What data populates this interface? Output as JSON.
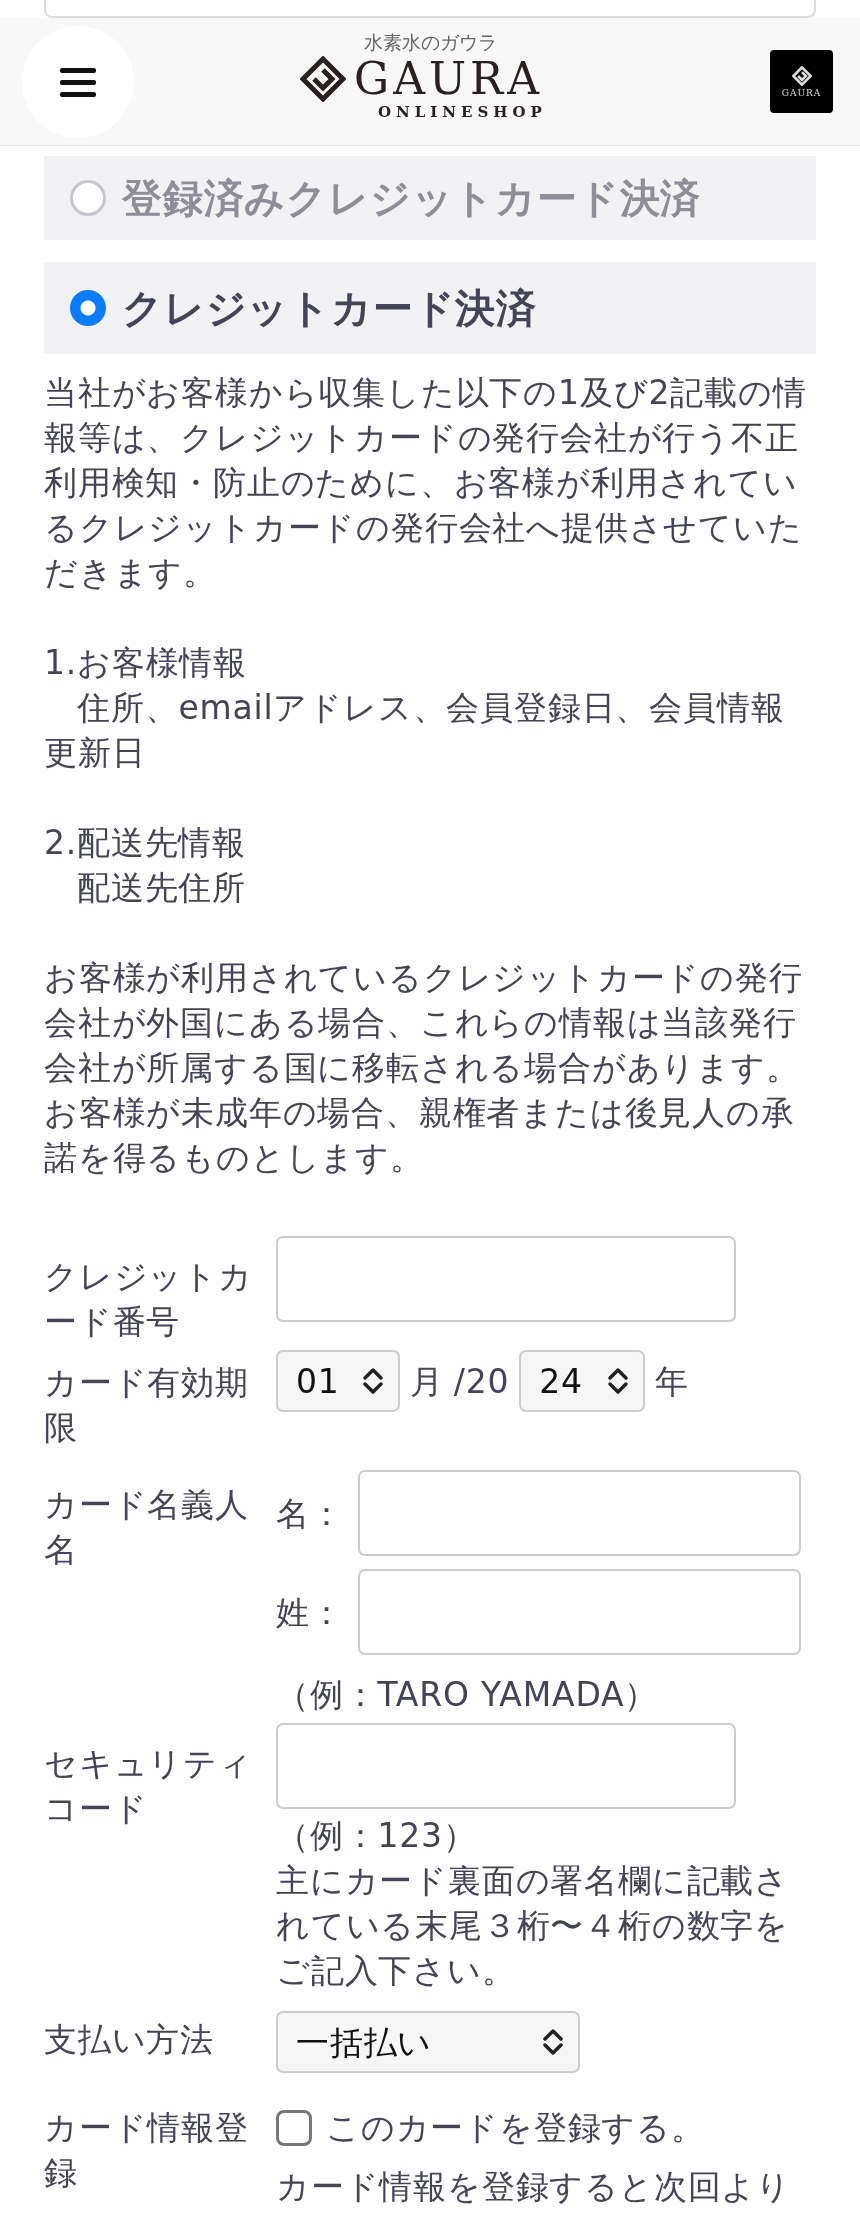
{
  "header": {
    "tagline": "水素水のガウラ",
    "logo_text": "GAURA",
    "logo_subtext": "ONLINESHOP",
    "badge_text": "GAURA"
  },
  "payment_options": [
    {
      "label": "登録済みクレジットカード決済",
      "selected": false
    },
    {
      "label": "クレジットカード決済",
      "selected": true
    }
  ],
  "notice": {
    "intro": "当社がお客様から収集した以下の1及び2記載の情報等は、クレジットカードの発行会社が行う不正利用検知・防止のために、お客様が利用されているクレジットカードの発行会社へ提供させていただきます。",
    "sections": [
      {
        "heading": "1.お客様情報",
        "detail": "住所、emailアドレス、会員登録日、会員情報更新日"
      },
      {
        "heading": "2.配送先情報",
        "detail": "配送先住所"
      }
    ],
    "closing": "お客様が利用されているクレジットカードの発行会社が外国にある場合、これらの情報は当該発行会社が所属する国に移転される場合があります。お客様が未成年の場合、親権者または後見人の承諾を得るものとします。"
  },
  "form": [
    {
      "kind": "text",
      "label": "クレジットカード番号"
    },
    {
      "kind": "expiry",
      "label": "カード有効期限",
      "month": "01",
      "month_unit": "月",
      "year_prefix": "/20",
      "year": "24",
      "year_unit": "年"
    },
    {
      "kind": "name",
      "label": "カード名義人名",
      "fields": [
        {
          "label": "名："
        },
        {
          "label": "姓："
        }
      ],
      "notes": [
        "（例：TARO YAMADA）"
      ]
    },
    {
      "kind": "text",
      "label": "セキュリティコード",
      "notes": [
        "（例：123）",
        "主にカード裏面の署名欄に記載されている末尾３桁〜４桁の数字をご記入下さい。"
      ]
    },
    {
      "kind": "select",
      "label": "支払い方法",
      "value": "一括払い"
    },
    {
      "kind": "checkbox",
      "label": "カード情報登録",
      "option": "このカードを登録する。",
      "checked": false,
      "notes": [
        "カード情報を登録すると次回より"
      ]
    }
  ]
}
